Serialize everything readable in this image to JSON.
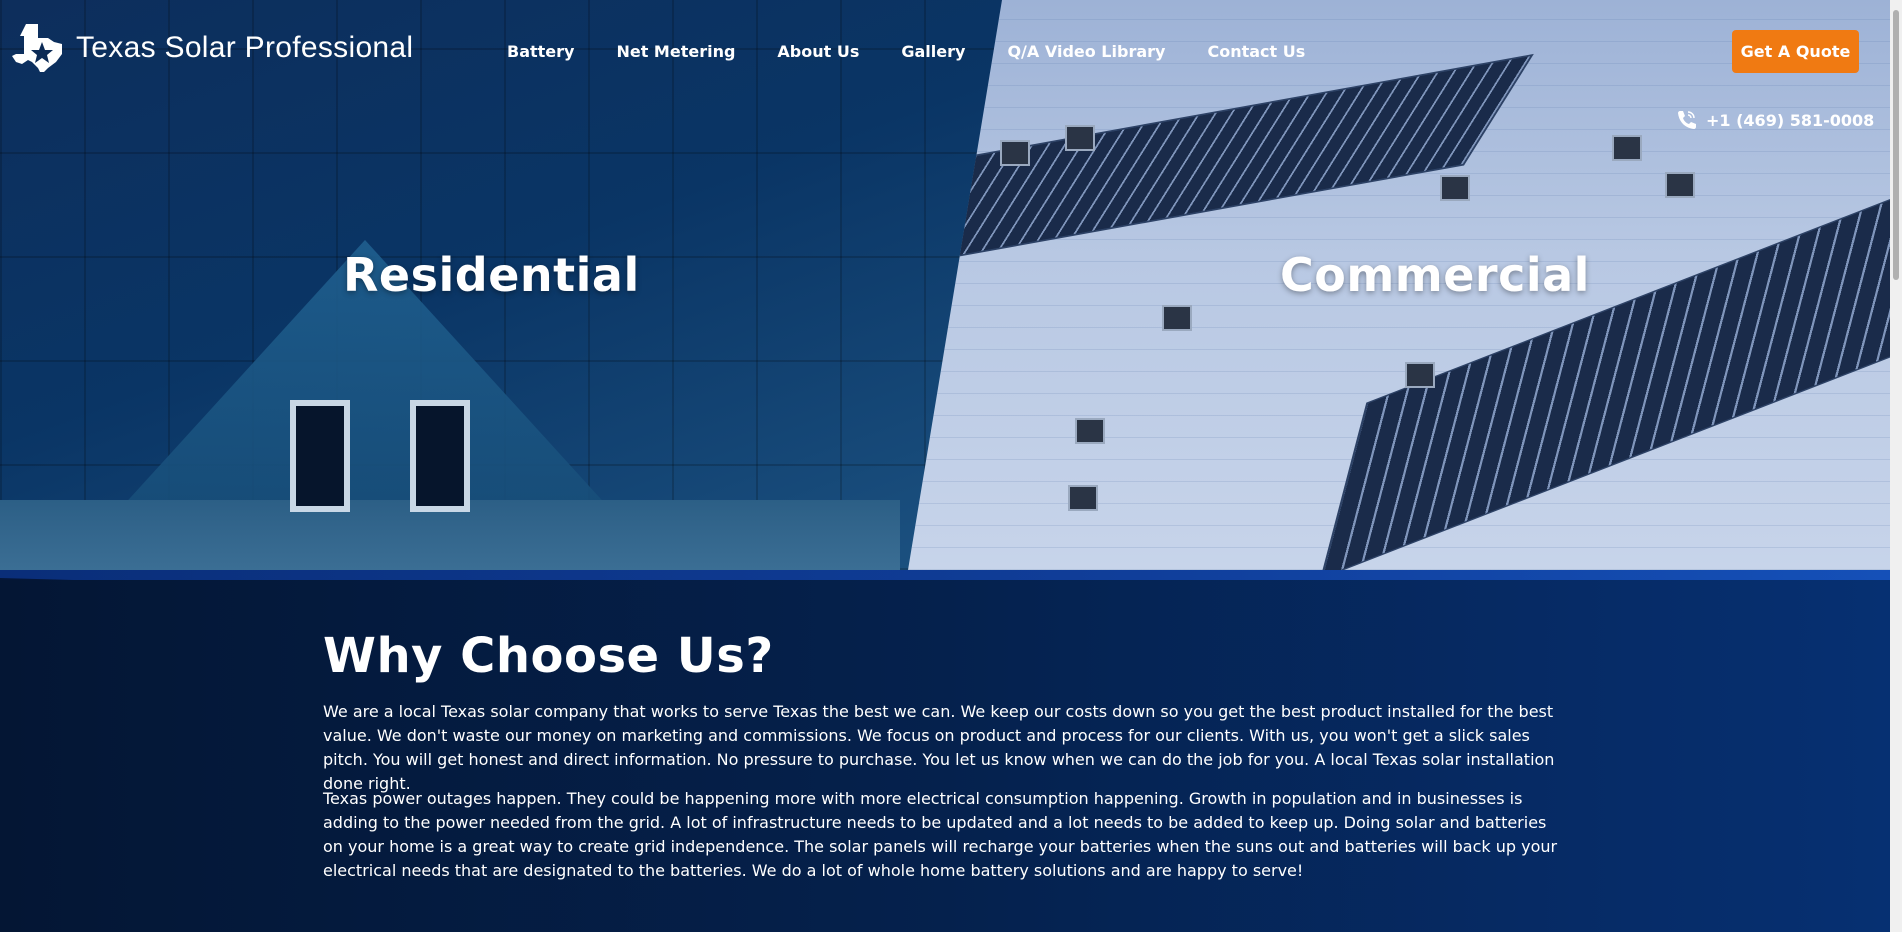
{
  "brand": {
    "name": "Texas Solar Professional",
    "accent": "#f07a12"
  },
  "nav": {
    "items": [
      {
        "label": "Battery"
      },
      {
        "label": "Net Metering"
      },
      {
        "label": "About Us"
      },
      {
        "label": "Gallery"
      },
      {
        "label": "Q/A Video Library"
      },
      {
        "label": "Contact Us"
      }
    ]
  },
  "header": {
    "cta_label": "Get A Quote",
    "phone": "+1 (469) 581-0008",
    "phone_icon": "phone-icon"
  },
  "hero": {
    "left_title": "Residential",
    "right_title": "Commercial"
  },
  "why": {
    "title": "Why Choose Us?",
    "paragraphs": [
      "We are a local Texas solar company that works to serve Texas the best we can. We keep our costs down so you get the best product installed for the best value. We don't waste our money on marketing and commissions. We focus on product and process for our clients. With us, you won't get a slick sales pitch. You will get honest and direct information. No pressure to purchase. You let us know when we can do the job for you. A local Texas solar installation done right.",
      "Texas power outages happen. They could be happening more with more electrical consumption happening. Growth in population and in businesses is adding to the power needed from the grid. A lot of infrastructure needs to be updated and a lot needs to be added to keep up. Doing solar and batteries on your home is a great way to create grid independence. The solar panels will recharge your batteries when the suns out and batteries will back up your electrical needs that are designated to the batteries. We do a lot of whole home battery solutions and are happy to serve!"
    ]
  }
}
